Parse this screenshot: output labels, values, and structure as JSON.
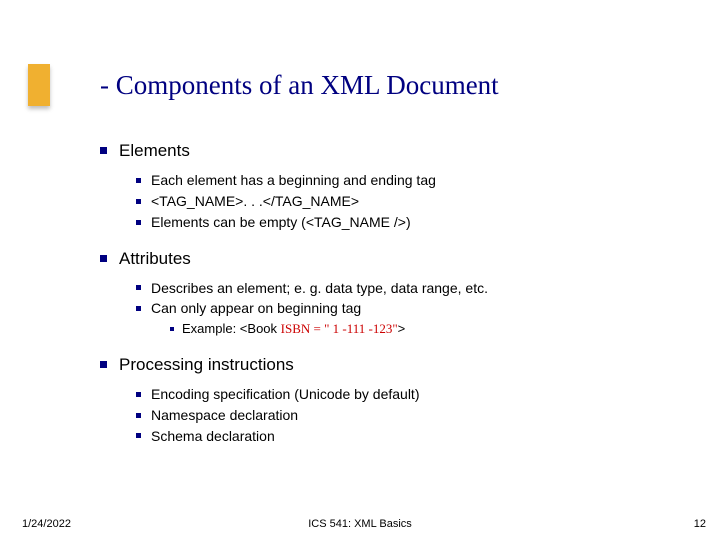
{
  "title": "- Components of an XML Document",
  "sections": [
    {
      "heading": "Elements",
      "items": [
        {
          "text": "Each element has a beginning and ending tag"
        },
        {
          "text": "<TAG_NAME>. . .</TAG_NAME>"
        },
        {
          "text": "Elements can be empty (<TAG_NAME />)"
        }
      ]
    },
    {
      "heading": "Attributes",
      "items": [
        {
          "text": "Describes an element; e. g. data type, data range, etc."
        },
        {
          "text": "Can only appear on beginning tag",
          "sub": [
            {
              "prefix": "Example: <Book ",
              "red": "ISBN = \" 1 -111 -123\"",
              "suffix": ">"
            }
          ]
        }
      ]
    },
    {
      "heading": "Processing instructions",
      "items": [
        {
          "text": "Encoding specification (Unicode by default)"
        },
        {
          "text": "Namespace declaration"
        },
        {
          "text": "Schema declaration"
        }
      ]
    }
  ],
  "footer": {
    "date": "1/24/2022",
    "center": "ICS 541: XML Basics",
    "page": "12"
  }
}
